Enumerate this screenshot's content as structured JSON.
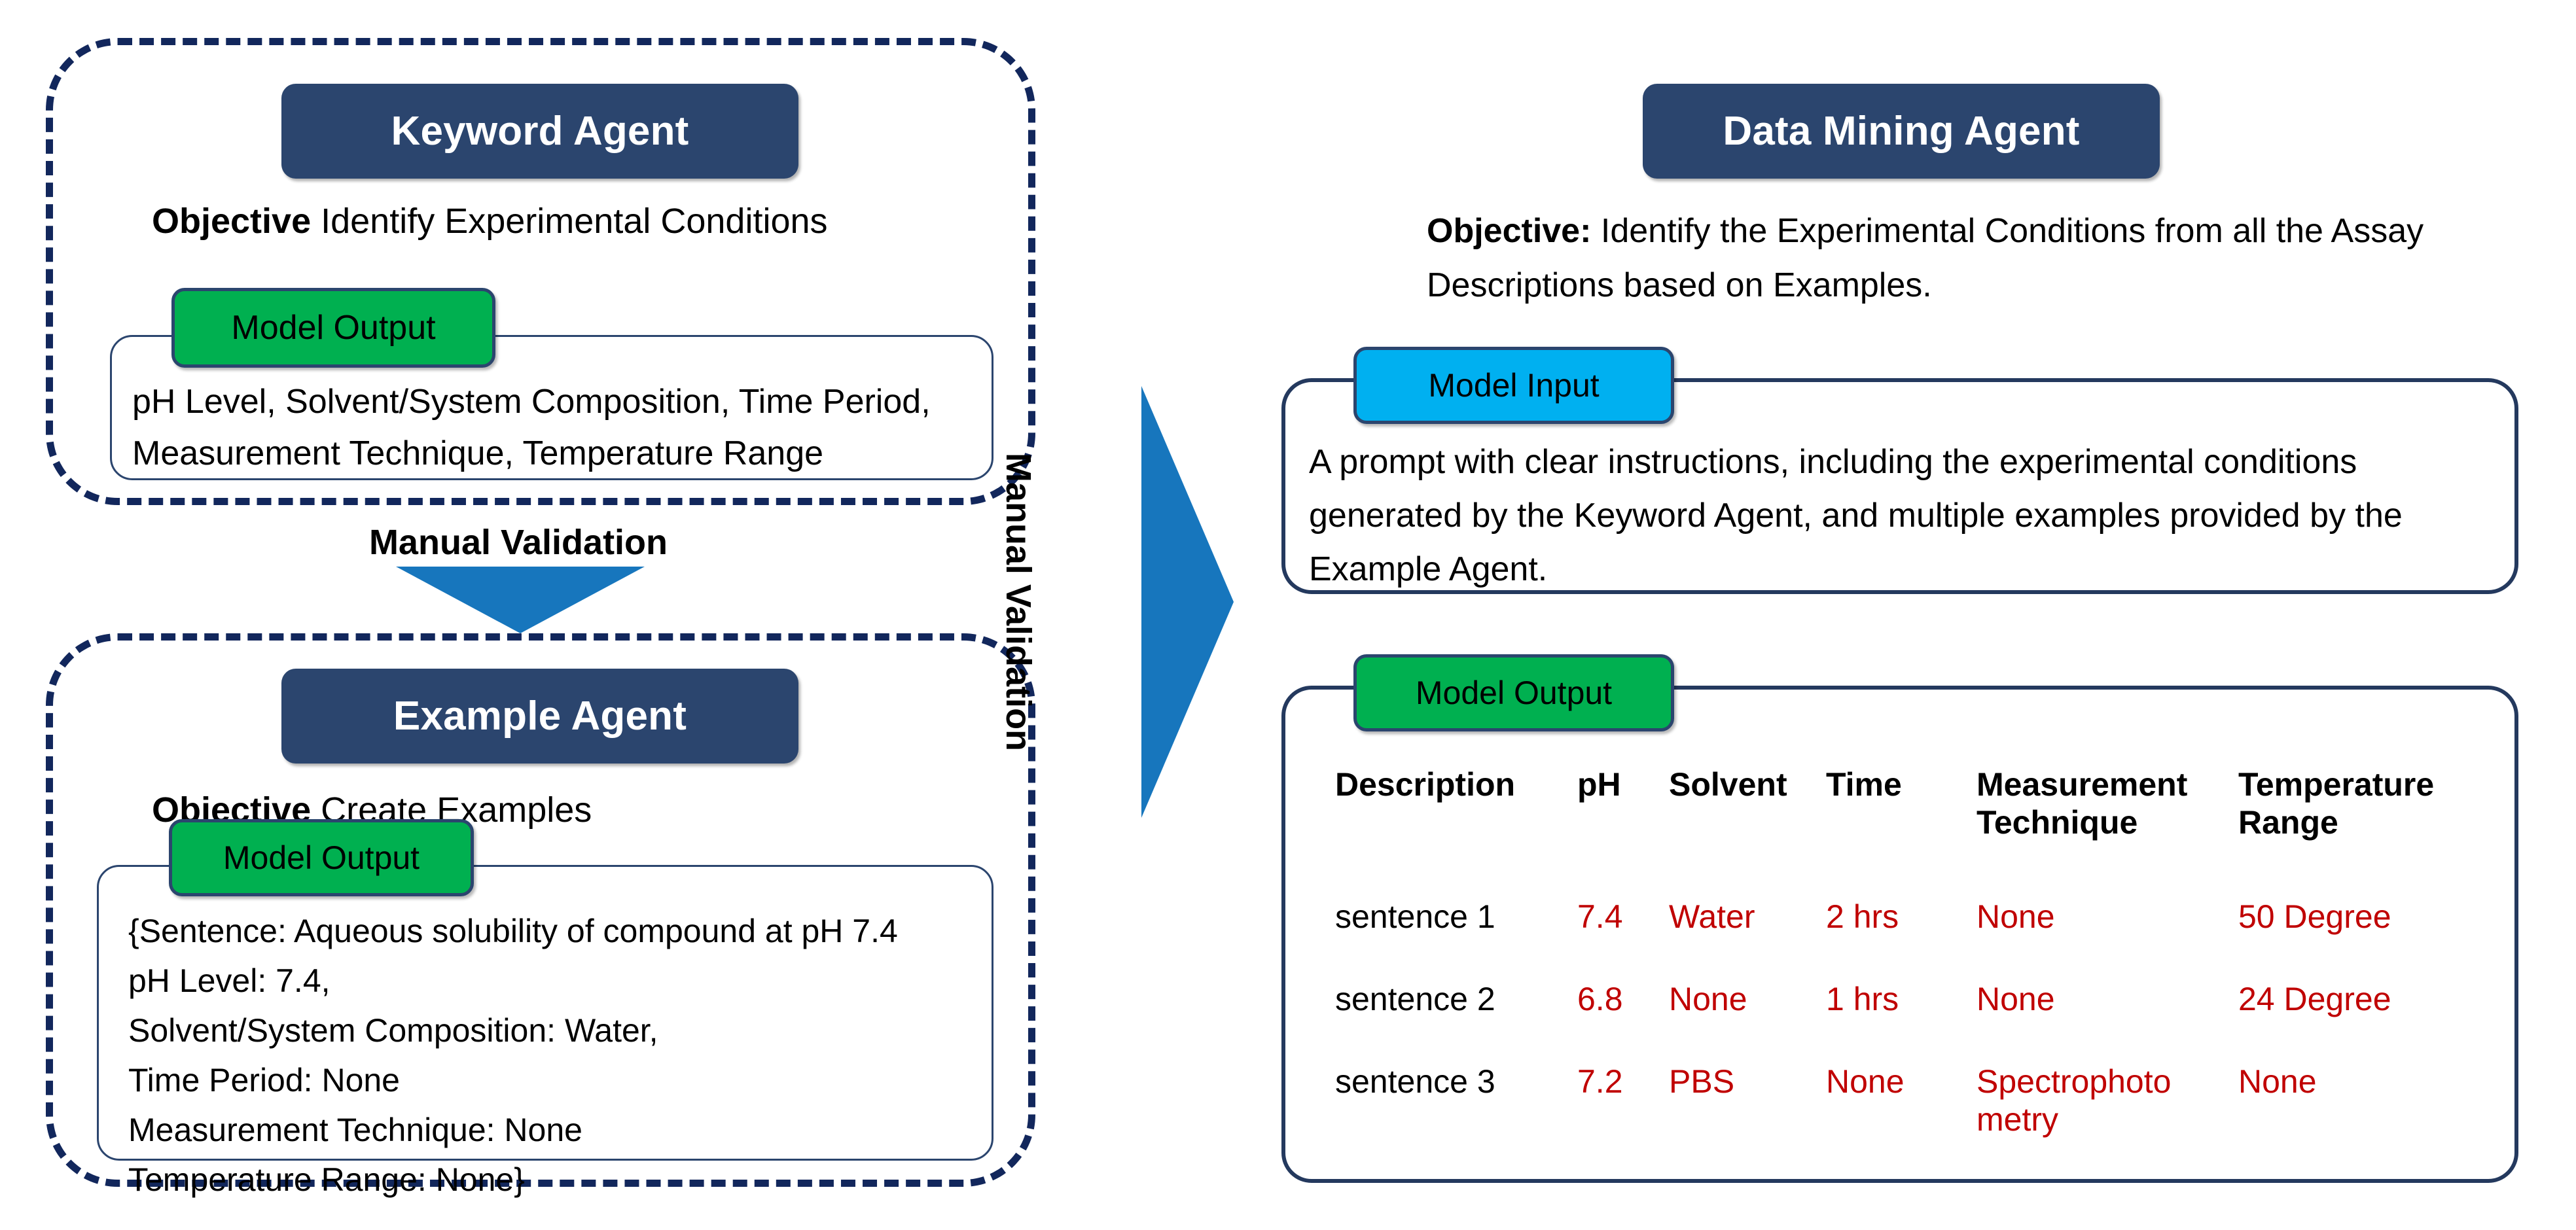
{
  "left": {
    "keyword_agent": {
      "title": "Keyword Agent",
      "objective_label": "Objective",
      "objective_text": " Identify Experimental Conditions",
      "output_badge": "Model Output",
      "output_text": "pH Level, Solvent/System Composition, Time Period,\nMeasurement Technique, Temperature Range"
    },
    "manual_validation_label": "Manual Validation",
    "example_agent": {
      "title": "Example Agent",
      "objective_label": "Objective",
      "objective_text": " Create Examples",
      "output_badge": "Model Output",
      "output_text": "{Sentence: Aqueous solubility of compound at pH 7.4\npH Level: 7.4,\nSolvent/System Composition: Water,\nTime Period: None\nMeasurement Technique: None\nTemperature Range: None}"
    }
  },
  "center": {
    "manual_validation_label": "Manual Validation"
  },
  "right": {
    "title": "Data Mining Agent",
    "objective_label": "Objective:",
    "objective_text": " Identify the Experimental Conditions from all the Assay Descriptions based on Examples.",
    "input_badge": "Model Input",
    "input_text": "A prompt with clear instructions, including the experimental conditions generated by the Keyword Agent, and multiple examples provided by the Example Agent.",
    "output_badge": "Model Output"
  },
  "chart_data": {
    "type": "table",
    "title": "Model Output",
    "columns": [
      "Description",
      "pH",
      "Solvent",
      "Time",
      "Measurement Technique",
      "Temperature Range"
    ],
    "rows": [
      [
        "sentence 1",
        "7.4",
        "Water",
        "2 hrs",
        "None",
        "50 Degree"
      ],
      [
        "sentence 2",
        "6.8",
        "None",
        "1 hrs",
        "None",
        "24 Degree"
      ],
      [
        "sentence 3",
        "7.2",
        "PBS",
        "None",
        "Spectrophoto metry",
        "None"
      ]
    ]
  },
  "colors": {
    "navy": "#2B456E",
    "dashed_navy": "#12275C",
    "green": "#00B050",
    "blue": "#00B0F0",
    "arrow_blue": "#1776BD",
    "red": "#C00000"
  }
}
